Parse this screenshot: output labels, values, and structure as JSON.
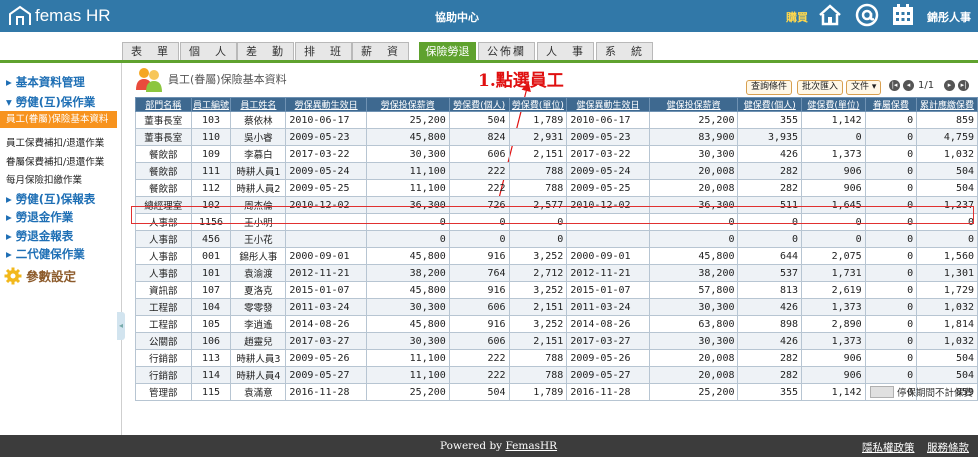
{
  "app": {
    "brand": "femas HR",
    "help_center": "協助中心",
    "buy": "購買",
    "user": "錦彤人事"
  },
  "tabs": [
    "表　單",
    "個　人",
    "差　勤",
    "排　班",
    "薪　資",
    "保險勞退",
    "公佈欄",
    "人　事",
    "系　統"
  ],
  "active_tab": "保險勞退",
  "sidebar": {
    "sections": [
      "基本資料管理",
      "勞健(互)保作業"
    ],
    "active_item": "員工(眷屬)保險基本資料",
    "items": [
      "員工保費補扣/退還作業",
      "眷屬保費補扣/退還作業",
      "每月保險扣繳作業"
    ],
    "sections2": [
      "勞健(互)保報表",
      "勞退金作業",
      "勞退金報表",
      "二代健保作業"
    ],
    "settings": "參數設定"
  },
  "page_title": "員工(眷屬)保險基本資料",
  "annotation": "1.點選員工",
  "toolbar": {
    "query": "查詢條件",
    "batch_import": "批次匯入",
    "file": "文件 ▾",
    "page": "1/1"
  },
  "table": {
    "headers": [
      "部門名稱",
      "員工編號",
      "員工姓名",
      "勞保異動生效日",
      "勞保投保薪資",
      "勞保費(個人)",
      "勞保費(單位)",
      "健保異動生效日",
      "健保投保薪資",
      "健保費(個人)",
      "健保費(單位)",
      "眷屬保費",
      "累計應繳保費"
    ],
    "rows": [
      [
        "董事長室",
        "103",
        "蔡依林",
        "2010-06-17",
        "25,200",
        "504",
        "1,789",
        "2010-06-17",
        "25,200",
        "355",
        "1,142",
        "0",
        "859"
      ],
      [
        "董事長室",
        "110",
        "吳小睿",
        "2009-05-23",
        "45,800",
        "824",
        "2,931",
        "2009-05-23",
        "83,900",
        "3,935",
        "0",
        "0",
        "4,759"
      ],
      [
        "餐飲部",
        "109",
        "李慕白",
        "2017-03-22",
        "30,300",
        "606",
        "2,151",
        "2017-03-22",
        "30,300",
        "426",
        "1,373",
        "0",
        "1,032"
      ],
      [
        "餐飲部",
        "111",
        "時耕人員1",
        "2009-05-24",
        "11,100",
        "222",
        "788",
        "2009-05-24",
        "20,008",
        "282",
        "906",
        "0",
        "504"
      ],
      [
        "餐飲部",
        "112",
        "時耕人員2",
        "2009-05-25",
        "11,100",
        "222",
        "788",
        "2009-05-25",
        "20,008",
        "282",
        "906",
        "0",
        "504"
      ],
      [
        "總經理室",
        "102",
        "周杰倫",
        "2010-12-02",
        "36,300",
        "726",
        "2,577",
        "2010-12-02",
        "36,300",
        "511",
        "1,645",
        "0",
        "1,237"
      ],
      [
        "人事部",
        "1156",
        "王小明",
        "",
        "0",
        "0",
        "0",
        "",
        "0",
        "0",
        "0",
        "0",
        "0"
      ],
      [
        "人事部",
        "456",
        "王小花",
        "",
        "0",
        "0",
        "0",
        "",
        "0",
        "0",
        "0",
        "0",
        "0"
      ],
      [
        "人事部",
        "001",
        "錦彤人事",
        "2000-09-01",
        "45,800",
        "916",
        "3,252",
        "2000-09-01",
        "45,800",
        "644",
        "2,075",
        "0",
        "1,560"
      ],
      [
        "人事部",
        "101",
        "袁渝渡",
        "2012-11-21",
        "38,200",
        "764",
        "2,712",
        "2012-11-21",
        "38,200",
        "537",
        "1,731",
        "0",
        "1,301"
      ],
      [
        "資訊部",
        "107",
        "夏洛克",
        "2015-01-07",
        "45,800",
        "916",
        "3,252",
        "2015-01-07",
        "57,800",
        "813",
        "2,619",
        "0",
        "1,729"
      ],
      [
        "工程部",
        "104",
        "零零發",
        "2011-03-24",
        "30,300",
        "606",
        "2,151",
        "2011-03-24",
        "30,300",
        "426",
        "1,373",
        "0",
        "1,032"
      ],
      [
        "工程部",
        "105",
        "李逍遙",
        "2014-08-26",
        "45,800",
        "916",
        "3,252",
        "2014-08-26",
        "63,800",
        "898",
        "2,890",
        "0",
        "1,814"
      ],
      [
        "公關部",
        "106",
        "趙靈兒",
        "2017-03-27",
        "30,300",
        "606",
        "2,151",
        "2017-03-27",
        "30,300",
        "426",
        "1,373",
        "0",
        "1,032"
      ],
      [
        "行銷部",
        "113",
        "時耕人員3",
        "2009-05-26",
        "11,100",
        "222",
        "788",
        "2009-05-26",
        "20,008",
        "282",
        "906",
        "0",
        "504"
      ],
      [
        "行銷部",
        "114",
        "時耕人員4",
        "2009-05-27",
        "11,100",
        "222",
        "788",
        "2009-05-27",
        "20,008",
        "282",
        "906",
        "0",
        "504"
      ],
      [
        "管理部",
        "115",
        "袁滿意",
        "2016-11-28",
        "25,200",
        "504",
        "1,789",
        "2016-11-28",
        "25,200",
        "355",
        "1,142",
        "0",
        "859"
      ]
    ]
  },
  "legend": "停保期間不計保費",
  "footer": {
    "powered_prefix": "Powered by ",
    "powered_link": "FemasHR",
    "privacy": "隱私權政策",
    "terms": "服務條款"
  }
}
